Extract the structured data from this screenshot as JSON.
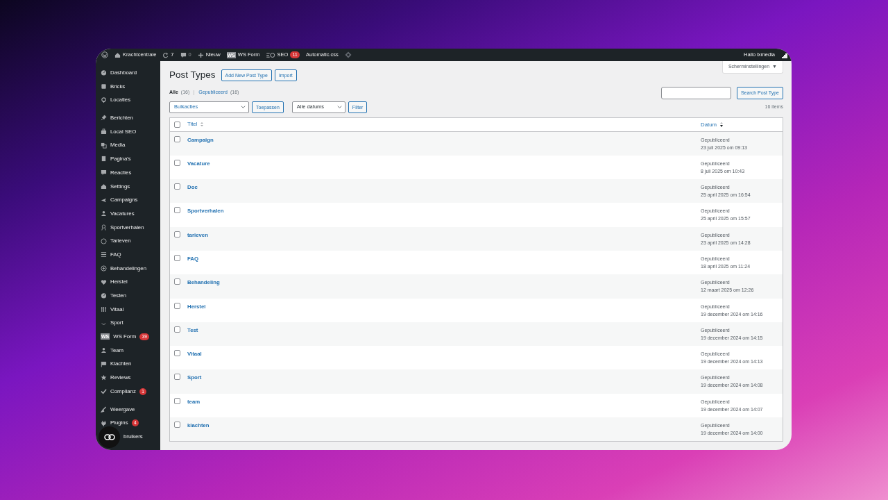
{
  "admin_bar": {
    "site": "Krachtcentrale",
    "updates": "7",
    "comments": "0",
    "new": "Nieuw",
    "ws_form": {
      "icon_text": "WS",
      "label": "WS Form"
    },
    "seo": {
      "label": "SEO",
      "badge": "11"
    },
    "automatic_css": "Automatic.css",
    "greeting": "Hallo lxmedia"
  },
  "sidebar": {
    "groups": [
      [
        {
          "label": "Dashboard"
        },
        {
          "label": "Bricks"
        },
        {
          "label": "Locaties"
        }
      ],
      [
        {
          "label": "Berichten"
        },
        {
          "label": "Local SEO"
        },
        {
          "label": "Media"
        },
        {
          "label": "Pagina's"
        },
        {
          "label": "Reacties"
        },
        {
          "label": "Settings"
        },
        {
          "label": "Campaigns"
        },
        {
          "label": "Vacatures"
        },
        {
          "label": "Sportverhalen"
        },
        {
          "label": "Tarieven"
        },
        {
          "label": "FAQ"
        },
        {
          "label": "Behandelingen"
        },
        {
          "label": "Herstel"
        },
        {
          "label": "Testen"
        },
        {
          "label": "Vitaal"
        },
        {
          "label": "Sport"
        },
        {
          "label": "WS Form",
          "icon_text": "WS",
          "badge": "39"
        },
        {
          "label": "Team"
        },
        {
          "label": "Klachten"
        },
        {
          "label": "Reviews"
        },
        {
          "label": "Complianz",
          "badge": "1"
        }
      ],
      [
        {
          "label": "Weergave"
        },
        {
          "label": "Plugins",
          "badge": "4"
        },
        {
          "label": "bruikers"
        }
      ]
    ]
  },
  "screen_options": {
    "label": "Scherminstellingen",
    "caret": "▼"
  },
  "page": {
    "title": "Post Types",
    "buttons": [
      "Add New Post Type",
      "Import"
    ]
  },
  "filters_links": [
    {
      "label": "Alle",
      "count": "(16)",
      "selected": true
    },
    {
      "label": "Gepubliceerd",
      "count": "(16)",
      "selected": false
    }
  ],
  "search": {
    "button": "Search Post Type"
  },
  "bulk": {
    "select": "Bulkacties",
    "apply": "Toepassen",
    "dates": "Alle datums",
    "filter": "Filter",
    "count": "16 items"
  },
  "table": {
    "columns": [
      {
        "label": "Titel",
        "sorted": false
      },
      {
        "label": "Datum",
        "sorted": true
      }
    ],
    "header_checked": false,
    "rows": [
      {
        "title": "Campaign",
        "status": "Gepubliceerd",
        "date": "23 juli 2025 om 09:13",
        "checked": false
      },
      {
        "title": "Vacature",
        "status": "Gepubliceerd",
        "date": "8 juli 2025 om 10:43",
        "checked": false
      },
      {
        "title": "Doc",
        "status": "Gepubliceerd",
        "date": "25 april 2025 om 16:54",
        "checked": false
      },
      {
        "title": "Sportverhalen",
        "status": "Gepubliceerd",
        "date": "25 april 2025 om 15:57",
        "checked": false
      },
      {
        "title": "tarieven",
        "status": "Gepubliceerd",
        "date": "23 april 2025 om 14:28",
        "checked": false
      },
      {
        "title": "FAQ",
        "status": "Gepubliceerd",
        "date": "18 april 2025 om 11:24",
        "checked": false
      },
      {
        "title": "Behandeling",
        "status": "Gepubliceerd",
        "date": "12 maart 2025 om 12:26",
        "checked": false
      },
      {
        "title": "Herstel",
        "status": "Gepubliceerd",
        "date": "19 december 2024 om 14:16",
        "checked": false
      },
      {
        "title": "Test",
        "status": "Gepubliceerd",
        "date": "19 december 2024 om 14:15",
        "checked": false
      },
      {
        "title": "Vitaal",
        "status": "Gepubliceerd",
        "date": "19 december 2024 om 14:13",
        "checked": false
      },
      {
        "title": "Sport",
        "status": "Gepubliceerd",
        "date": "19 december 2024 om 14:08",
        "checked": false
      },
      {
        "title": "team",
        "status": "Gepubliceerd",
        "date": "19 december 2024 om 14:07",
        "checked": false
      },
      {
        "title": "klachten",
        "status": "Gepubliceerd",
        "date": "19 december 2024 om 14:00",
        "checked": false
      }
    ]
  }
}
